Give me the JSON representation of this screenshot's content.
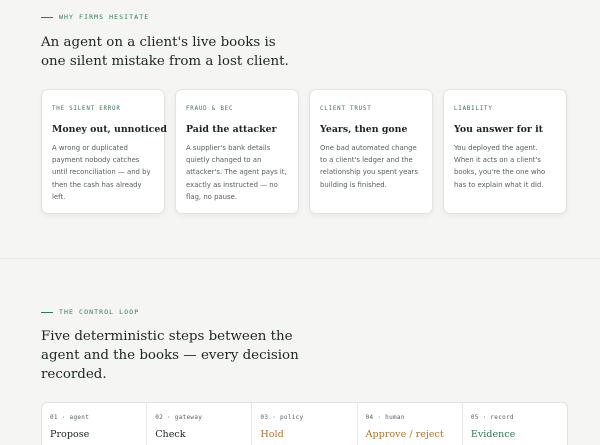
{
  "section1": {
    "eyebrow": "WHY FIRMS HESITATE",
    "headline_line1": "An agent on a client's live books is",
    "headline_line2": "one silent mistake from a lost client.",
    "cards": [
      {
        "tag": "THE SILENT ERROR",
        "title": "Money out, unnoticed",
        "body": [
          "A wrong or duplicated",
          "payment nobody catches",
          "until reconciliation — and by",
          "then the cash has already",
          "left."
        ]
      },
      {
        "tag": "FRAUD & BEC",
        "title": "Paid the attacker",
        "body": [
          "A supplier's bank details",
          "quietly changed to an",
          "attacker's. The agent pays it,",
          "exactly as instructed — no",
          "flag, no pause."
        ]
      },
      {
        "tag": "CLIENT TRUST",
        "title": "Years, then gone",
        "body": [
          "One bad automated change",
          "to a client's ledger and the",
          "relationship you spent years",
          "building is finished."
        ]
      },
      {
        "tag": "LIABILITY",
        "title": "You answer for it",
        "body": [
          "You deployed the agent.",
          "When it acts on a client's",
          "books, you're the one who",
          "has to explain what it did."
        ]
      }
    ]
  },
  "section2": {
    "eyebrow": "THE CONTROL LOOP",
    "headline_line1": "Five deterministic steps between the",
    "headline_line2": "agent and the books — every decision",
    "headline_line3": "recorded.",
    "steps": [
      {
        "num": "01 · agent",
        "label": "Propose"
      },
      {
        "num": "02 · gateway",
        "label": "Check"
      },
      {
        "num": "03 · policy",
        "label": "Hold"
      },
      {
        "num": "04 · human",
        "label": "Approve / reject"
      },
      {
        "num": "05 · record",
        "label": "Evidence"
      }
    ]
  },
  "colors": {
    "accent_green": "#2f7a52",
    "hold_orange": "#b5722a",
    "neutral_text": "#1c2620"
  }
}
